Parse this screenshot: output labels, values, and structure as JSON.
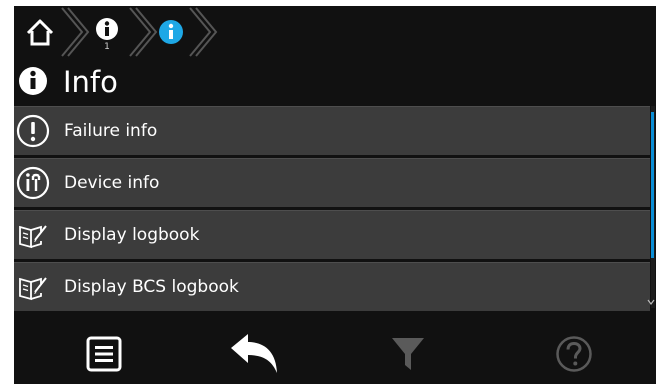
{
  "breadcrumb": {
    "home": "home-icon",
    "level1_icon": "info-icon",
    "level1_sub": "1",
    "level2_icon": "info-icon",
    "accent": "#1ea8e6"
  },
  "title": {
    "icon": "info-icon",
    "text": "Info"
  },
  "menu": {
    "items": [
      {
        "icon": "exclamation-circle-icon",
        "label": "Failure info"
      },
      {
        "icon": "device-info-icon",
        "label": "Device info"
      },
      {
        "icon": "logbook-icon",
        "label": "Display logbook"
      },
      {
        "icon": "logbook-icon",
        "label": "Display BCS logbook"
      }
    ]
  },
  "toolbar": {
    "buttons": [
      {
        "icon": "menu-list-icon",
        "enabled": true
      },
      {
        "icon": "back-arrow-icon",
        "enabled": true
      },
      {
        "icon": "filter-icon",
        "enabled": false
      },
      {
        "icon": "help-icon",
        "enabled": false
      }
    ]
  },
  "colors": {
    "background": "#111111",
    "item": "#3c3c3c",
    "accent": "#0a8ed6",
    "disabled": "#5a5a5a"
  }
}
